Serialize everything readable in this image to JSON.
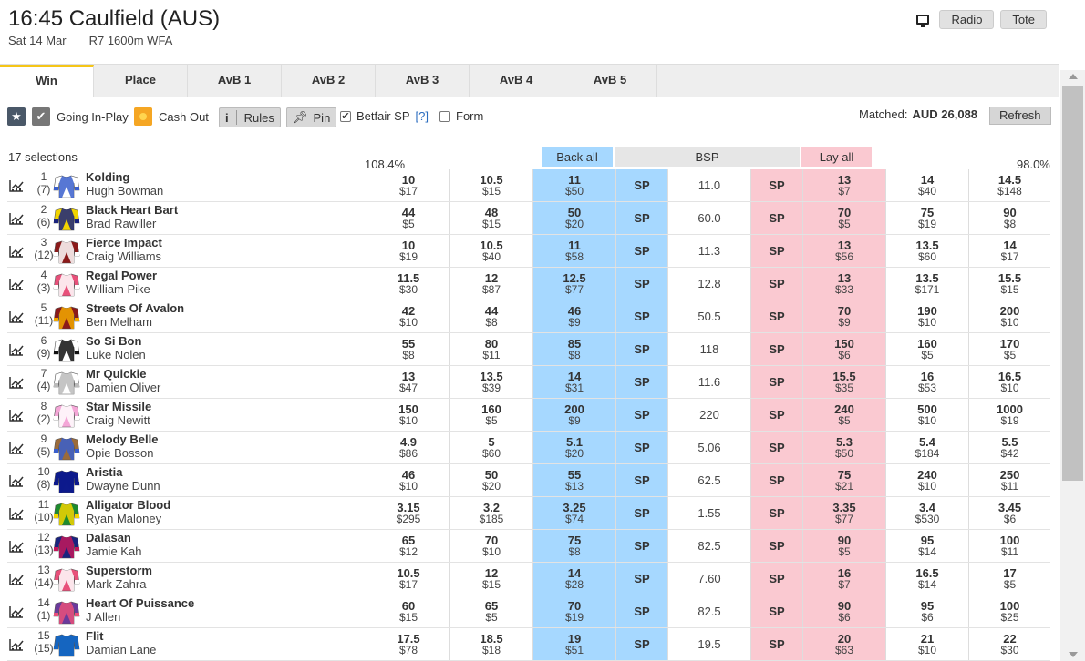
{
  "header": {
    "title": "16:45 Caulfield (AUS)",
    "date": "Sat 14 Mar",
    "race": "R7 1600m WFA",
    "radio_label": "Radio",
    "tote_label": "Tote"
  },
  "tabs": [
    {
      "label": "Win"
    },
    {
      "label": "Place"
    },
    {
      "label": "AvB 1"
    },
    {
      "label": "AvB 2"
    },
    {
      "label": "AvB 3"
    },
    {
      "label": "AvB 4"
    },
    {
      "label": "AvB 5"
    }
  ],
  "toolbar": {
    "going_inplay": "Going In-Play",
    "cash_out": "Cash Out",
    "rules": "Rules",
    "pin": "Pin",
    "betfair_sp": "Betfair SP",
    "help": "[?]",
    "form": "Form",
    "matched_label": "Matched:",
    "matched_value": "AUD 26,088",
    "refresh": "Refresh"
  },
  "columns": {
    "selections": "17 selections",
    "back_pct": "108.4%",
    "back_all": "Back all",
    "bsp": "BSP",
    "lay_all": "Lay all",
    "lay_pct": "98.0%"
  },
  "colors": {
    "back": "#a6d8ff",
    "lay": "#fac9d1",
    "active_tab": "#f5c518"
  },
  "sp_label": "SP",
  "runners": [
    {
      "num": "1",
      "draw": "(7)",
      "name": "Kolding",
      "jockey": "Hugh Bowman",
      "silk": [
        "#ffffff",
        "#3a5fcd"
      ],
      "prices": [
        [
          "10",
          "$17"
        ],
        [
          "10.5",
          "$15"
        ],
        [
          "11",
          "$50"
        ]
      ],
      "bsp": "11.0",
      "lays": [
        [
          "13",
          "$7"
        ],
        [
          "14",
          "$40"
        ],
        [
          "14.5",
          "$148"
        ]
      ]
    },
    {
      "num": "2",
      "draw": "(6)",
      "name": "Black Heart Bart",
      "jockey": "Brad Rawiller",
      "silk": [
        "#f2d400",
        "#1a237e"
      ],
      "prices": [
        [
          "44",
          "$5"
        ],
        [
          "48",
          "$15"
        ],
        [
          "50",
          "$20"
        ]
      ],
      "bsp": "60.0",
      "lays": [
        [
          "70",
          "$5"
        ],
        [
          "75",
          "$19"
        ],
        [
          "90",
          "$8"
        ]
      ]
    },
    {
      "num": "3",
      "draw": "(12)",
      "name": "Fierce Impact",
      "jockey": "Craig Williams",
      "silk": [
        "#8b1a1a",
        "#ffffff"
      ],
      "prices": [
        [
          "10",
          "$19"
        ],
        [
          "10.5",
          "$40"
        ],
        [
          "11",
          "$58"
        ]
      ],
      "bsp": "11.3",
      "lays": [
        [
          "13",
          "$56"
        ],
        [
          "13.5",
          "$60"
        ],
        [
          "14",
          "$17"
        ]
      ]
    },
    {
      "num": "4",
      "draw": "(3)",
      "name": "Regal Power",
      "jockey": "William Pike",
      "silk": [
        "#e8507a",
        "#ffffff"
      ],
      "prices": [
        [
          "11.5",
          "$30"
        ],
        [
          "12",
          "$87"
        ],
        [
          "12.5",
          "$77"
        ]
      ],
      "bsp": "12.8",
      "lays": [
        [
          "13",
          "$33"
        ],
        [
          "13.5",
          "$171"
        ],
        [
          "15.5",
          "$15"
        ]
      ]
    },
    {
      "num": "5",
      "draw": "(11)",
      "name": "Streets Of Avalon",
      "jockey": "Ben Melham",
      "silk": [
        "#8b1a1a",
        "#f2a900"
      ],
      "prices": [
        [
          "42",
          "$10"
        ],
        [
          "44",
          "$8"
        ],
        [
          "46",
          "$9"
        ]
      ],
      "bsp": "50.5",
      "lays": [
        [
          "70",
          "$9"
        ],
        [
          "190",
          "$10"
        ],
        [
          "200",
          "$10"
        ]
      ]
    },
    {
      "num": "6",
      "draw": "(9)",
      "name": "So Si Bon",
      "jockey": "Luke Nolen",
      "silk": [
        "#ffffff",
        "#111111"
      ],
      "prices": [
        [
          "55",
          "$8"
        ],
        [
          "80",
          "$11"
        ],
        [
          "85",
          "$8"
        ]
      ],
      "bsp": "118",
      "lays": [
        [
          "150",
          "$6"
        ],
        [
          "160",
          "$5"
        ],
        [
          "170",
          "$5"
        ]
      ]
    },
    {
      "num": "7",
      "draw": "(4)",
      "name": "Mr Quickie",
      "jockey": "Damien Oliver",
      "silk": [
        "#ffffff",
        "#bbbbbb"
      ],
      "prices": [
        [
          "13",
          "$47"
        ],
        [
          "13.5",
          "$39"
        ],
        [
          "14",
          "$31"
        ]
      ],
      "bsp": "11.6",
      "lays": [
        [
          "15.5",
          "$35"
        ],
        [
          "16",
          "$53"
        ],
        [
          "16.5",
          "$10"
        ]
      ]
    },
    {
      "num": "8",
      "draw": "(2)",
      "name": "Star Missile",
      "jockey": "Craig Newitt",
      "silk": [
        "#f4a6d7",
        "#ffffff"
      ],
      "prices": [
        [
          "150",
          "$10"
        ],
        [
          "160",
          "$5"
        ],
        [
          "200",
          "$9"
        ]
      ],
      "bsp": "220",
      "lays": [
        [
          "240",
          "$5"
        ],
        [
          "500",
          "$10"
        ],
        [
          "1000",
          "$19"
        ]
      ]
    },
    {
      "num": "9",
      "draw": "(5)",
      "name": "Melody Belle",
      "jockey": "Opie Bosson",
      "silk": [
        "#9b6b3a",
        "#3a5fcd"
      ],
      "prices": [
        [
          "4.9",
          "$86"
        ],
        [
          "5",
          "$60"
        ],
        [
          "5.1",
          "$20"
        ]
      ],
      "bsp": "5.06",
      "lays": [
        [
          "5.3",
          "$50"
        ],
        [
          "5.4",
          "$184"
        ],
        [
          "5.5",
          "$42"
        ]
      ]
    },
    {
      "num": "10",
      "draw": "(8)",
      "name": "Aristia",
      "jockey": "Dwayne Dunn",
      "silk": [
        "#0d1a8c",
        "#0d1a8c"
      ],
      "prices": [
        [
          "46",
          "$10"
        ],
        [
          "50",
          "$20"
        ],
        [
          "55",
          "$13"
        ]
      ],
      "bsp": "62.5",
      "lays": [
        [
          "75",
          "$21"
        ],
        [
          "240",
          "$10"
        ],
        [
          "250",
          "$11"
        ]
      ]
    },
    {
      "num": "11",
      "draw": "(10)",
      "name": "Alligator Blood",
      "jockey": "Ryan Maloney",
      "silk": [
        "#1e8b2e",
        "#f2d400"
      ],
      "prices": [
        [
          "3.15",
          "$295"
        ],
        [
          "3.2",
          "$185"
        ],
        [
          "3.25",
          "$74"
        ]
      ],
      "bsp": "1.55",
      "lays": [
        [
          "3.35",
          "$77"
        ],
        [
          "3.4",
          "$530"
        ],
        [
          "3.45",
          "$6"
        ]
      ]
    },
    {
      "num": "12",
      "draw": "(13)",
      "name": "Dalasan",
      "jockey": "Jamie Kah",
      "silk": [
        "#1a237e",
        "#c2185b"
      ],
      "prices": [
        [
          "65",
          "$12"
        ],
        [
          "70",
          "$10"
        ],
        [
          "75",
          "$8"
        ]
      ],
      "bsp": "82.5",
      "lays": [
        [
          "90",
          "$5"
        ],
        [
          "95",
          "$14"
        ],
        [
          "100",
          "$11"
        ]
      ]
    },
    {
      "num": "13",
      "draw": "(14)",
      "name": "Superstorm",
      "jockey": "Mark Zahra",
      "silk": [
        "#e8507a",
        "#ffffff"
      ],
      "prices": [
        [
          "10.5",
          "$17"
        ],
        [
          "12",
          "$15"
        ],
        [
          "14",
          "$28"
        ]
      ],
      "bsp": "7.60",
      "lays": [
        [
          "16",
          "$7"
        ],
        [
          "16.5",
          "$14"
        ],
        [
          "17",
          "$5"
        ]
      ]
    },
    {
      "num": "14",
      "draw": "(1)",
      "name": "Heart Of Puissance",
      "jockey": "J Allen",
      "silk": [
        "#6a3a9b",
        "#e8507a"
      ],
      "prices": [
        [
          "60",
          "$15"
        ],
        [
          "65",
          "$5"
        ],
        [
          "70",
          "$19"
        ]
      ],
      "bsp": "82.5",
      "lays": [
        [
          "90",
          "$6"
        ],
        [
          "95",
          "$6"
        ],
        [
          "100",
          "$25"
        ]
      ]
    },
    {
      "num": "15",
      "draw": "(15)",
      "name": "Flit",
      "jockey": "Damian Lane",
      "silk": [
        "#1565c0",
        "#1565c0"
      ],
      "prices": [
        [
          "17.5",
          "$78"
        ],
        [
          "18.5",
          "$18"
        ],
        [
          "19",
          "$51"
        ]
      ],
      "bsp": "19.5",
      "lays": [
        [
          "20",
          "$63"
        ],
        [
          "21",
          "$10"
        ],
        [
          "22",
          "$30"
        ]
      ]
    }
  ]
}
